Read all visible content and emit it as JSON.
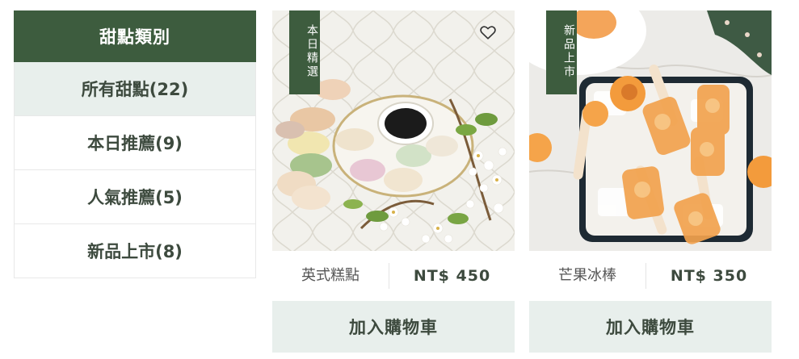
{
  "sidebar": {
    "title": "甜點類別",
    "items": [
      {
        "label": "所有甜點(22)"
      },
      {
        "label": "本日推薦(9)"
      },
      {
        "label": "人氣推薦(5)"
      },
      {
        "label": "新品上市(8)"
      }
    ]
  },
  "products": [
    {
      "badge": "本日精選",
      "name": "英式糕點",
      "price": "NT$ 450",
      "button": "加入購物車",
      "favorite_icon": "heart-outline-icon"
    },
    {
      "badge": "新品上市",
      "name": "芒果冰棒",
      "price": "NT$ 350",
      "button": "加入購物車"
    }
  ],
  "colors": {
    "primary": "#3d5c3e",
    "light": "#e8efec"
  }
}
